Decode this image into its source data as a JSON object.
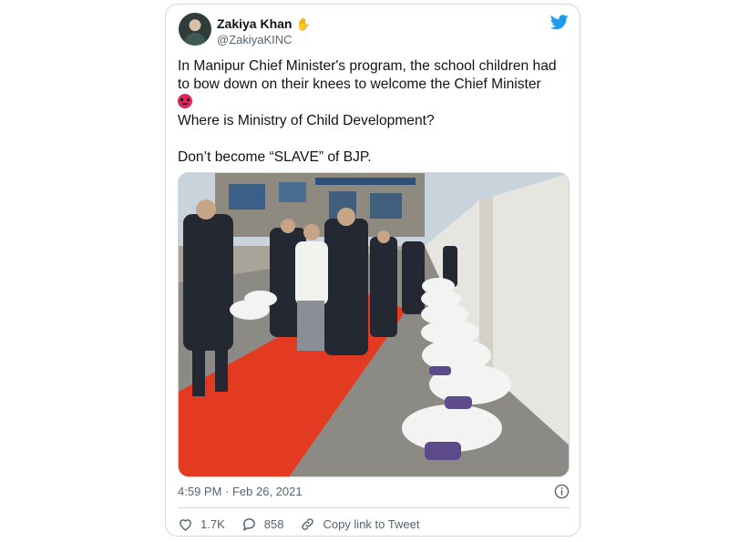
{
  "tweet": {
    "author_name": "Zakiya Khan",
    "name_emoji": "✋",
    "handle": "@ZakiyaKINC",
    "text_lines": [
      "In Manipur Chief Minister's program, the school children had",
      "to bow down on their knees to welcome the Chief Minister"
    ],
    "text_line_3": "Where is Ministry of Child Development?",
    "text_line_4": "Don’t become “SLAVE” of BJP.",
    "timestamp": "4:59 PM · Feb 26, 2021",
    "likes": "1.7K",
    "replies": "858",
    "copy_link_label": "Copy link to Tweet"
  },
  "icons": {
    "logo": "twitter-bird-icon",
    "emoji": "angry-face-emoji",
    "info": "info-icon",
    "like": "heart-icon",
    "reply": "reply-bubble-icon",
    "copy": "link-icon"
  },
  "colors": {
    "brand": "#1d9bf0",
    "text": "#0f1419",
    "secondary": "#536471",
    "border": "#cfd9de",
    "emoji": "#e0245e"
  }
}
